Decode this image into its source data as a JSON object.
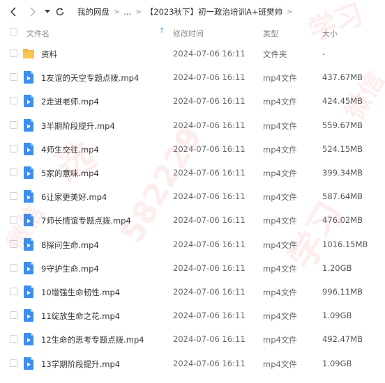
{
  "breadcrumb": {
    "root": "我的网盘",
    "ellipsis": "...",
    "current": "【2023秋下】初一政治培训A+班樊帅"
  },
  "columns": {
    "name": "文件名",
    "modified": "修改时间",
    "type": "类型",
    "size": "大小"
  },
  "files": [
    {
      "name": "资料",
      "modified": "2024-07-06 16:11",
      "type": "文件夹",
      "size": "-",
      "icon": "folder-icon"
    },
    {
      "name": "1友谊的天空专题点拨.mp4",
      "modified": "2024-07-06 16:11",
      "type": "mp4文件",
      "size": "437.67MB",
      "icon": "video-file-icon"
    },
    {
      "name": "2走进老师.mp4",
      "modified": "2024-07-06 16:11",
      "type": "mp4文件",
      "size": "424.45MB",
      "icon": "video-file-icon"
    },
    {
      "name": "3半期阶段提升.mp4",
      "modified": "2024-07-06 16:11",
      "type": "mp4文件",
      "size": "559.67MB",
      "icon": "video-file-icon"
    },
    {
      "name": "4师生交往.mp4",
      "modified": "2024-07-06 16:11",
      "type": "mp4文件",
      "size": "524.15MB",
      "icon": "video-file-icon"
    },
    {
      "name": "5家的意味.mp4",
      "modified": "2024-07-06 16:11",
      "type": "mp4文件",
      "size": "399.34MB",
      "icon": "video-file-icon"
    },
    {
      "name": "6让家更美好.mp4",
      "modified": "2024-07-06 16:11",
      "type": "mp4文件",
      "size": "587.64MB",
      "icon": "video-file-icon"
    },
    {
      "name": "7师长情谊专题点拨.mp4",
      "modified": "2024-07-06 16:11",
      "type": "mp4文件",
      "size": "476.02MB",
      "icon": "video-file-icon"
    },
    {
      "name": "8探问生命.mp4",
      "modified": "2024-07-06 16:11",
      "type": "mp4文件",
      "size": "1016.15MB",
      "icon": "video-file-icon"
    },
    {
      "name": "9守护生命.mp4",
      "modified": "2024-07-06 16:11",
      "type": "mp4文件",
      "size": "1.20GB",
      "icon": "video-file-icon"
    },
    {
      "name": "10增强生命韧性.mp4",
      "modified": "2024-07-06 16:11",
      "type": "mp4文件",
      "size": "996.11MB",
      "icon": "video-file-icon"
    },
    {
      "name": "11绽放生命之花.mp4",
      "modified": "2024-07-06 16:11",
      "type": "mp4文件",
      "size": "1.09GB",
      "icon": "video-file-icon"
    },
    {
      "name": "12生命的思考专题点拨.mp4",
      "modified": "2024-07-06 16:11",
      "type": "mp4文件",
      "size": "492.47MB",
      "icon": "video-file-icon"
    },
    {
      "name": "13学期阶段提升.mp4",
      "modified": "2024-07-06 16:11",
      "type": "mp4文件",
      "size": "1.09GB",
      "icon": "video-file-icon"
    }
  ],
  "watermark": {
    "text1": "学习",
    "text2": "微信",
    "text3": "582229",
    "text4": "选"
  },
  "colors": {
    "folder": "#f5b73b",
    "video": "#3a8ff0",
    "accent": "#2c8df4"
  }
}
